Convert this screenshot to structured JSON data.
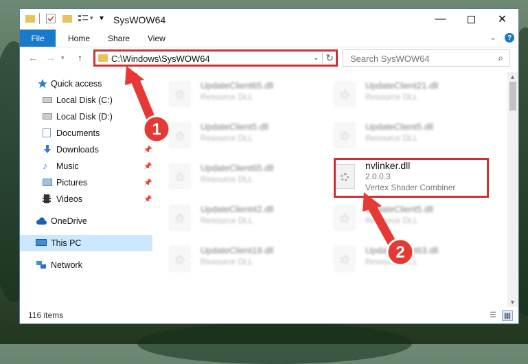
{
  "window": {
    "title": "SysWOW64"
  },
  "ribbon": {
    "tabs": [
      "File",
      "Home",
      "Share",
      "View"
    ]
  },
  "address": {
    "path": "C:\\Windows\\SysWOW64"
  },
  "search": {
    "placeholder": "Search SysWOW64"
  },
  "sidebar": {
    "items": [
      {
        "label": "Quick access"
      },
      {
        "label": "Local Disk (C:)"
      },
      {
        "label": "Local Disk (D:)"
      },
      {
        "label": "Documents"
      },
      {
        "label": "Downloads"
      },
      {
        "label": "Music"
      },
      {
        "label": "Pictures"
      },
      {
        "label": "Videos"
      },
      {
        "label": "OneDrive"
      },
      {
        "label": "This PC"
      },
      {
        "label": "Network"
      }
    ]
  },
  "files": [
    {
      "name": "UpdateClient65.dll",
      "desc": "Resource DLL"
    },
    {
      "name": "UpdateClient21.dll",
      "desc": "Resource DLL"
    },
    {
      "name": "UpdateClient5.dll",
      "desc": "Resource DLL"
    },
    {
      "name": "UpdateClient5.dll",
      "desc": "Resource DLL"
    },
    {
      "name": "UpdateClient65.dll",
      "desc": "Resource DLL"
    },
    {
      "name": "nvlinker.dll",
      "version": "2.0.0.3",
      "desc": "Vertex Shader Combiner"
    },
    {
      "name": "UpdateClient42.dll",
      "desc": "Resource DLL"
    },
    {
      "name": "UpdateClient5.dll",
      "desc": "Resource DLL"
    },
    {
      "name": "UpdateClient19.dll",
      "desc": "Resource DLL"
    },
    {
      "name": "UpdateClient63.dll",
      "desc": "Resource DLL"
    }
  ],
  "status": {
    "items_text": "116 items"
  },
  "annotations": {
    "step1": "1",
    "step2": "2"
  },
  "colors": {
    "accent": "#1979ca",
    "highlight": "#d32f2f",
    "selection": "#cce8ff"
  }
}
